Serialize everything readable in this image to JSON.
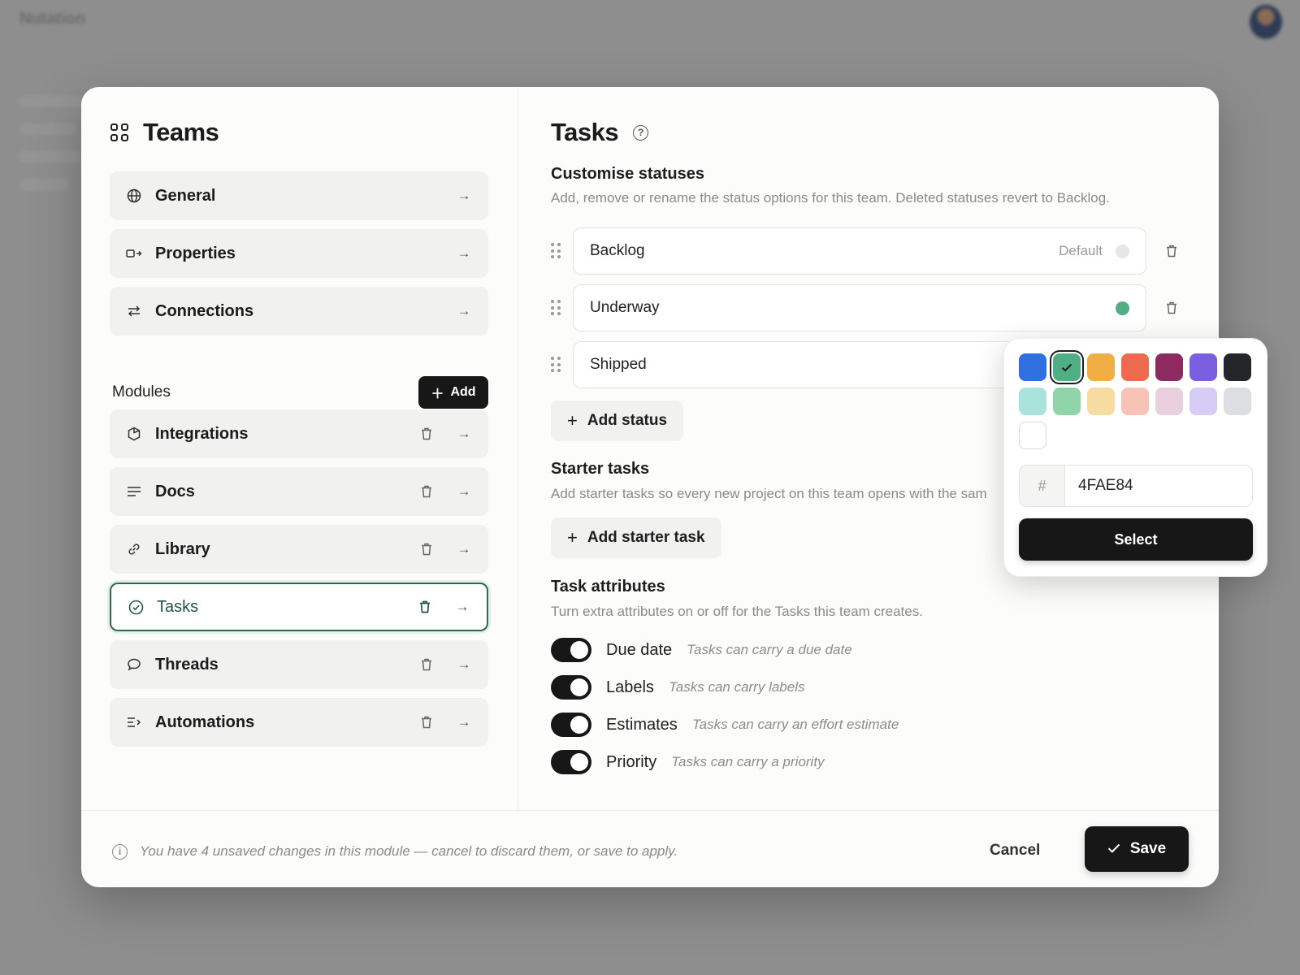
{
  "background": {
    "app_name": "Nutation"
  },
  "sidebar": {
    "title": "Teams",
    "settings": [
      {
        "label": "General",
        "icon": "globe-icon"
      },
      {
        "label": "Properties",
        "icon": "properties-icon"
      },
      {
        "label": "Connections",
        "icon": "arrows-exchange-icon"
      }
    ],
    "modules_label": "Modules",
    "add_label": "Add",
    "modules": [
      {
        "label": "Integrations",
        "icon": "hexagon-icon",
        "active": false
      },
      {
        "label": "Docs",
        "icon": "lines-icon",
        "active": false
      },
      {
        "label": "Library",
        "icon": "link-icon",
        "active": false
      },
      {
        "label": "Tasks",
        "icon": "check-circle-icon",
        "active": true
      },
      {
        "label": "Threads",
        "icon": "chat-bubble-icon",
        "active": false
      },
      {
        "label": "Automations",
        "icon": "automation-icon",
        "active": false
      }
    ]
  },
  "main": {
    "title": "Tasks",
    "statuses": {
      "title": "Customise statuses",
      "description": "Add, remove or rename the status options for this team. Deleted statuses revert to Backlog.",
      "items": [
        {
          "name": "Backlog",
          "tag": "Default",
          "color": "#e6e6e4"
        },
        {
          "name": "Underway",
          "tag": "",
          "color": "#4FAE84"
        },
        {
          "name": "Shipped",
          "tag": "",
          "color": ""
        }
      ],
      "add_label": "Add status"
    },
    "starter": {
      "title": "Starter tasks",
      "description": "Add starter tasks so every new project on this team opens with the sam",
      "add_label": "Add starter task"
    },
    "attributes": {
      "title": "Task attributes",
      "description": "Turn extra attributes on or off for the Tasks this team creates.",
      "items": [
        {
          "label": "Due date",
          "hint": "Tasks can carry a due date",
          "on": true
        },
        {
          "label": "Labels",
          "hint": "Tasks can carry labels",
          "on": true
        },
        {
          "label": "Estimates",
          "hint": "Tasks can carry an effort estimate",
          "on": true
        },
        {
          "label": "Priority",
          "hint": "Tasks can carry a priority",
          "on": true
        }
      ]
    }
  },
  "color_picker": {
    "swatches": [
      "#2f6fe0",
      "#4FAE84",
      "#f0ae45",
      "#ee6a50",
      "#8e2a62",
      "#7b5fe0",
      "#24262a",
      "#a9e3dc",
      "#8fd3a6",
      "#f7dca2",
      "#f9c2b6",
      "#ead0de",
      "#d6ccf5",
      "#dcdee2",
      "#ffffff"
    ],
    "selected_index": 1,
    "hex_prefix": "#",
    "hex_value": "4FAE84",
    "select_label": "Select"
  },
  "footer": {
    "note": "You have 4 unsaved changes in this module — cancel to discard them, or save to apply.",
    "cancel_label": "Cancel",
    "save_label": "Save"
  }
}
